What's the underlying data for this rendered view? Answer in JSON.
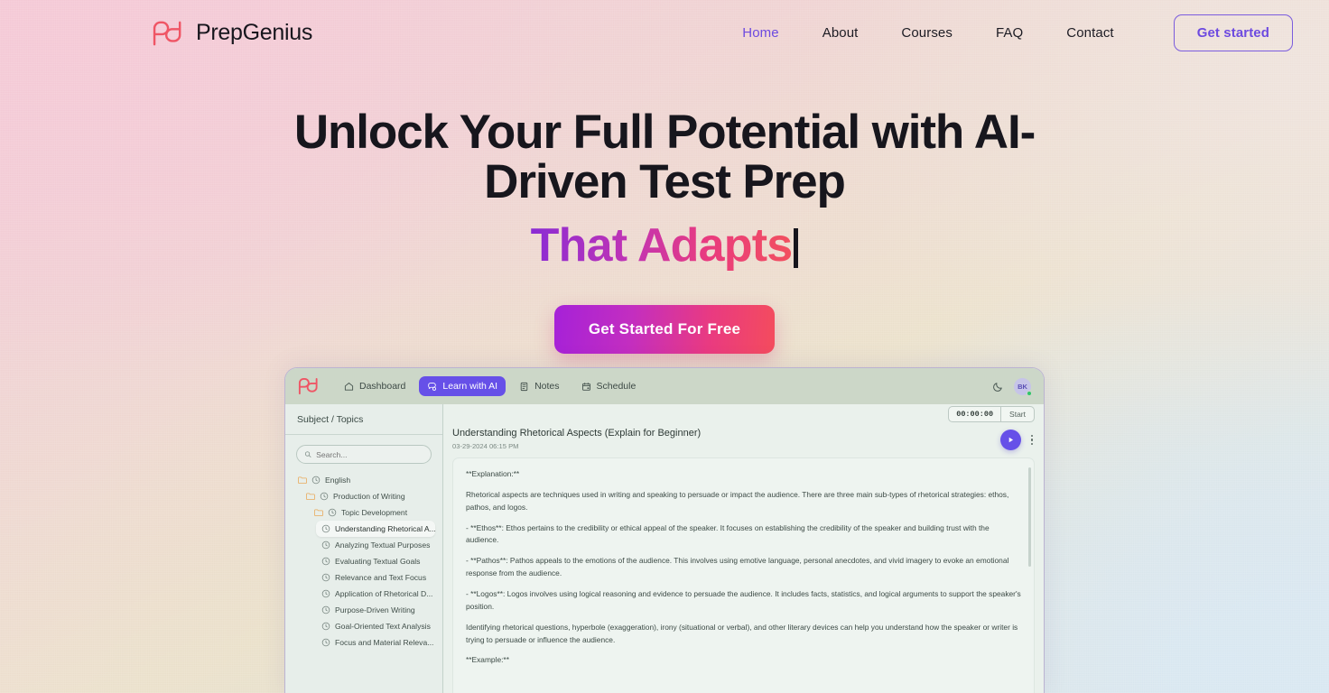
{
  "brand": {
    "name": "PrepGenius",
    "logo_icon": "pg-monogram-icon"
  },
  "nav": {
    "links": [
      {
        "label": "Home",
        "active": true
      },
      {
        "label": "About",
        "active": false
      },
      {
        "label": "Courses",
        "active": false
      },
      {
        "label": "FAQ",
        "active": false
      },
      {
        "label": "Contact",
        "active": false
      }
    ],
    "cta_label": "Get started"
  },
  "hero": {
    "headline": "Unlock Your Full Potential with AI-Driven Test Prep",
    "accent": "That Adapts",
    "cta_label": "Get Started For Free",
    "accent_gradient_from": "#8a2bd4",
    "accent_gradient_to": "#f2505f"
  },
  "app": {
    "logo_icon": "pg-monogram-icon",
    "nav": [
      {
        "label": "Dashboard",
        "icon": "home-icon",
        "active": false
      },
      {
        "label": "Learn with AI",
        "icon": "ai-chat-icon",
        "active": true
      },
      {
        "label": "Notes",
        "icon": "notes-icon",
        "active": false
      },
      {
        "label": "Schedule",
        "icon": "calendar-icon",
        "active": false
      }
    ],
    "theme_toggle_icon": "moon-icon",
    "avatar_initials": "BK",
    "sidebar": {
      "header": "Subject / Topics",
      "search_placeholder": "Search...",
      "search_value": "",
      "tree": [
        {
          "label": "English",
          "depth": 1,
          "type": "folder",
          "selected": false
        },
        {
          "label": "Production of Writing",
          "depth": 2,
          "type": "folder",
          "selected": false
        },
        {
          "label": "Topic Development",
          "depth": 3,
          "type": "folder",
          "selected": false
        },
        {
          "label": "Understanding Rhetorical A...",
          "depth": 4,
          "type": "topic",
          "selected": true
        },
        {
          "label": "Analyzing Textual Purposes",
          "depth": 4,
          "type": "topic",
          "selected": false
        },
        {
          "label": "Evaluating Textual Goals",
          "depth": 4,
          "type": "topic",
          "selected": false
        },
        {
          "label": "Relevance and Text Focus",
          "depth": 4,
          "type": "topic",
          "selected": false
        },
        {
          "label": "Application of Rhetorical D...",
          "depth": 4,
          "type": "topic",
          "selected": false
        },
        {
          "label": "Purpose-Driven Writing",
          "depth": 4,
          "type": "topic",
          "selected": false
        },
        {
          "label": "Goal-Oriented Text Analysis",
          "depth": 4,
          "type": "topic",
          "selected": false
        },
        {
          "label": "Focus and Material Releva...",
          "depth": 4,
          "type": "topic",
          "selected": false
        }
      ]
    },
    "timer": {
      "value": "00:00:00",
      "button_label": "Start"
    },
    "document": {
      "title": "Understanding Rhetorical Aspects (Explain for Beginner)",
      "date": "03-29-2024 06:15 PM",
      "play_icon": "play-icon",
      "menu_icon": "kebab-menu-icon",
      "paragraphs": [
        "**Explanation:**",
        "Rhetorical aspects are techniques used in writing and speaking to persuade or impact the audience. There are three main sub-types of rhetorical strategies: ethos, pathos, and logos.",
        "- **Ethos**: Ethos pertains to the credibility or ethical appeal of the speaker. It focuses on establishing the credibility of the speaker and building trust with the audience.",
        "- **Pathos**: Pathos appeals to the emotions of the audience. This involves using emotive language, personal anecdotes, and vivid imagery to evoke an emotional response from the audience.",
        "- **Logos**: Logos involves using logical reasoning and evidence to persuade the audience. It includes facts, statistics, and logical arguments to support the speaker's position.",
        "Identifying rhetorical questions, hyperbole (exaggeration), irony (situational or verbal), and other literary devices can help you understand how the speaker or writer is trying to persuade or influence the audience.",
        "**Example:**"
      ]
    }
  }
}
